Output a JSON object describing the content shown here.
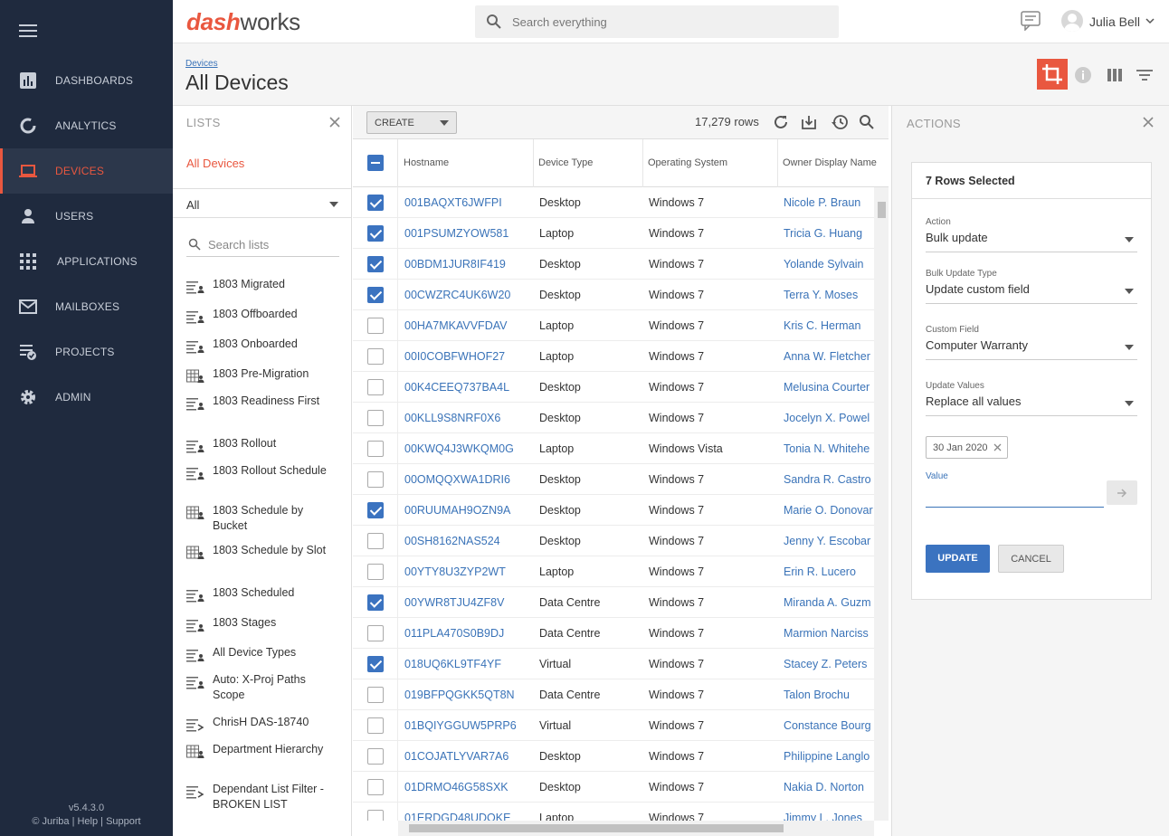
{
  "app": {
    "brand_part1": "dash",
    "brand_part2": "works"
  },
  "search": {
    "placeholder": "Search everything"
  },
  "user": {
    "name": "Julia Bell"
  },
  "nav": [
    {
      "label": "DASHBOARDS",
      "icon": "bar-chart-icon"
    },
    {
      "label": "ANALYTICS",
      "icon": "donut-chart-icon"
    },
    {
      "label": "DEVICES",
      "icon": "laptop-icon",
      "active": true
    },
    {
      "label": "USERS",
      "icon": "person-icon"
    },
    {
      "label": "APPLICATIONS",
      "icon": "grid-icon"
    },
    {
      "label": "MAILBOXES",
      "icon": "envelope-icon"
    },
    {
      "label": "PROJECTS",
      "icon": "checklist-icon"
    },
    {
      "label": "ADMIN",
      "icon": "gear-icon"
    }
  ],
  "footer": {
    "version": "v5.4.3.0",
    "links": "© Juriba | Help | Support"
  },
  "page": {
    "breadcrumb": "Devices",
    "title": "All Devices"
  },
  "lists": {
    "title": "LISTS",
    "selected": "All Devices",
    "filter_value": "All",
    "search_placeholder": "Search lists",
    "items": [
      {
        "label": "1803 Migrated",
        "icon": "user-list-icon"
      },
      {
        "label": "1803 Offboarded",
        "icon": "user-list-icon"
      },
      {
        "label": "1803 Onboarded",
        "icon": "user-list-icon"
      },
      {
        "label": "1803 Pre-Migration",
        "icon": "table-user-icon"
      },
      {
        "label": "1803 Readiness First",
        "icon": "user-list-icon"
      },
      {
        "label": "1803 Rollout",
        "icon": "user-list-icon"
      },
      {
        "label": "1803 Rollout Schedule",
        "icon": "user-list-icon"
      },
      {
        "label": "1803 Schedule by Bucket",
        "icon": "table-user-icon"
      },
      {
        "label": "1803 Schedule by Slot",
        "icon": "table-user-icon"
      },
      {
        "label": "1803 Scheduled",
        "icon": "user-list-icon"
      },
      {
        "label": "1803 Stages",
        "icon": "user-list-icon"
      },
      {
        "label": "All Device Types",
        "icon": "user-list-icon"
      },
      {
        "label": "Auto: X-Proj Paths Scope",
        "icon": "user-list-icon"
      },
      {
        "label": "ChrisH DAS-18740",
        "icon": "shared-list-icon"
      },
      {
        "label": "Department Hierarchy",
        "icon": "table-user-icon"
      },
      {
        "label": "Dependant List Filter - BROKEN LIST",
        "icon": "shared-list-icon"
      }
    ]
  },
  "grid": {
    "create_label": "CREATE",
    "row_count": "17,279 rows",
    "columns": [
      "Hostname",
      "Device Type",
      "Operating System",
      "Owner Display Name"
    ],
    "rows": [
      {
        "checked": true,
        "hostname": "001BAQXT6JWFPI",
        "type": "Desktop",
        "os": "Windows 7",
        "owner": "Nicole P. Braun"
      },
      {
        "checked": true,
        "hostname": "001PSUMZYOW581",
        "type": "Laptop",
        "os": "Windows 7",
        "owner": "Tricia G. Huang"
      },
      {
        "checked": true,
        "hostname": "00BDM1JUR8IF419",
        "type": "Desktop",
        "os": "Windows 7",
        "owner": "Yolande Sylvain"
      },
      {
        "checked": true,
        "hostname": "00CWZRC4UK6W20",
        "type": "Desktop",
        "os": "Windows 7",
        "owner": "Terra Y. Moses"
      },
      {
        "checked": false,
        "hostname": "00HA7MKAVVFDAV",
        "type": "Laptop",
        "os": "Windows 7",
        "owner": "Kris C. Herman"
      },
      {
        "checked": false,
        "hostname": "00I0COBFWHOF27",
        "type": "Laptop",
        "os": "Windows 7",
        "owner": "Anna W. Fletcher"
      },
      {
        "checked": false,
        "hostname": "00K4CEEQ737BA4L",
        "type": "Desktop",
        "os": "Windows 7",
        "owner": "Melusina Courter"
      },
      {
        "checked": false,
        "hostname": "00KLL9S8NRF0X6",
        "type": "Desktop",
        "os": "Windows 7",
        "owner": "Jocelyn X. Powel"
      },
      {
        "checked": false,
        "hostname": "00KWQ4J3WKQM0G",
        "type": "Laptop",
        "os": "Windows Vista",
        "owner": "Tonia N. Whitehe"
      },
      {
        "checked": false,
        "hostname": "00OMQQXWA1DRI6",
        "type": "Desktop",
        "os": "Windows 7",
        "owner": "Sandra R. Castro"
      },
      {
        "checked": true,
        "hostname": "00RUUMAH9OZN9A",
        "type": "Desktop",
        "os": "Windows 7",
        "owner": "Marie O. Donovar"
      },
      {
        "checked": false,
        "hostname": "00SH8162NAS524",
        "type": "Desktop",
        "os": "Windows 7",
        "owner": "Jenny Y. Escobar"
      },
      {
        "checked": false,
        "hostname": "00YTY8U3ZYP2WT",
        "type": "Laptop",
        "os": "Windows 7",
        "owner": "Erin R. Lucero"
      },
      {
        "checked": true,
        "hostname": "00YWR8TJU4ZF8V",
        "type": "Data Centre",
        "os": "Windows 7",
        "owner": "Miranda A. Guzm"
      },
      {
        "checked": false,
        "hostname": "011PLA470S0B9DJ",
        "type": "Data Centre",
        "os": "Windows 7",
        "owner": "Marmion Narciss"
      },
      {
        "checked": true,
        "hostname": "018UQ6KL9TF4YF",
        "type": "Virtual",
        "os": "Windows 7",
        "owner": "Stacey Z. Peters"
      },
      {
        "checked": false,
        "hostname": "019BFPQGKK5QT8N",
        "type": "Data Centre",
        "os": "Windows 7",
        "owner": "Talon Brochu"
      },
      {
        "checked": false,
        "hostname": "01BQIYGGUW5PRP6",
        "type": "Virtual",
        "os": "Windows 7",
        "owner": "Constance Bourg"
      },
      {
        "checked": false,
        "hostname": "01COJATLYVAR7A6",
        "type": "Desktop",
        "os": "Windows 7",
        "owner": "Philippine Langlo"
      },
      {
        "checked": false,
        "hostname": "01DRMO46G58SXK",
        "type": "Desktop",
        "os": "Windows 7",
        "owner": "Nakia D. Norton"
      },
      {
        "checked": false,
        "hostname": "01ERDGD48UDOKE",
        "type": "Laptop",
        "os": "Windows 7",
        "owner": "Jimmy L. Jones"
      }
    ]
  },
  "actions": {
    "title": "ACTIONS",
    "selected_label": "7 Rows Selected",
    "fields": [
      {
        "label": "Action",
        "value": "Bulk update"
      },
      {
        "label": "Bulk Update Type",
        "value": "Update custom field"
      },
      {
        "label": "Custom Field",
        "value": "Computer Warranty"
      },
      {
        "label": "Update Values",
        "value": "Replace all values"
      }
    ],
    "chip": "30 Jan 2020",
    "value_label": "Value",
    "update_label": "UPDATE",
    "cancel_label": "CANCEL"
  },
  "colors": {
    "accent": "#e9573f",
    "primary": "#3b73c0",
    "sidebar": "#1f2a3e"
  }
}
